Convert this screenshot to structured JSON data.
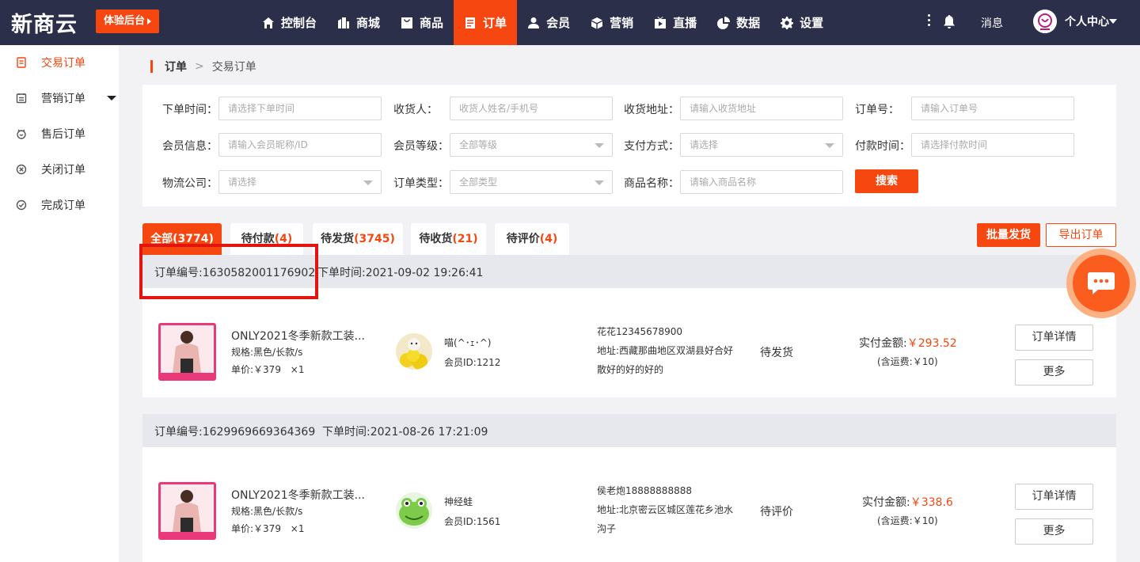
{
  "brand": {
    "logo": "新商云",
    "trial_button": "体验后台"
  },
  "nav": [
    {
      "label": "控制台",
      "icon": "home-icon"
    },
    {
      "label": "商城",
      "icon": "store-icon"
    },
    {
      "label": "商品",
      "icon": "goods-icon"
    },
    {
      "label": "订单",
      "icon": "order-icon",
      "active": true
    },
    {
      "label": "会员",
      "icon": "user-icon"
    },
    {
      "label": "营销",
      "icon": "cube-icon"
    },
    {
      "label": "直播",
      "icon": "live-icon"
    },
    {
      "label": "数据",
      "icon": "pie-chart-icon"
    },
    {
      "label": "设置",
      "icon": "gear-icon"
    }
  ],
  "header_right": {
    "messages": "消息",
    "user_center": "个人中心"
  },
  "sidebar": [
    {
      "label": "交易订单",
      "icon": "document-icon",
      "active": true
    },
    {
      "label": "营销订单",
      "icon": "list-icon"
    },
    {
      "label": "售后订单",
      "icon": "service-icon"
    },
    {
      "label": "关闭订单",
      "icon": "close-circle-icon"
    },
    {
      "label": "完成订单",
      "icon": "check-circle-icon"
    }
  ],
  "breadcrumb": {
    "parent": "订单",
    "separator": ">",
    "current": "交易订单"
  },
  "filters": {
    "order_time": {
      "label": "下单时间：",
      "placeholder": "请选择下单时间"
    },
    "receiver": {
      "label": "收货人：",
      "placeholder": "收货人姓名/手机号"
    },
    "address": {
      "label": "收货地址：",
      "placeholder": "请输入收货地址"
    },
    "order_no": {
      "label": "订单号：",
      "placeholder": "请输入订单号"
    },
    "member_info": {
      "label": "会员信息：",
      "placeholder": "请输入会员昵称/ID"
    },
    "member_level": {
      "label": "会员等级：",
      "value": "全部等级"
    },
    "pay_method": {
      "label": "支付方式：",
      "value": "请选择"
    },
    "pay_time": {
      "label": "付款时间：",
      "placeholder": "请选择付款时间"
    },
    "logistics": {
      "label": "物流公司：",
      "value": "请选择"
    },
    "order_type": {
      "label": "订单类型：",
      "value": "全部类型"
    },
    "product_name": {
      "label": "商品名称：",
      "placeholder": "请输入商品名称"
    },
    "search_button": "搜索"
  },
  "tabs": [
    {
      "label": "全部",
      "count": "(3774)",
      "active": true
    },
    {
      "label": "待付款",
      "count": "(4)"
    },
    {
      "label": "待发货",
      "count": "(3745)"
    },
    {
      "label": "待收货",
      "count": "(21)"
    },
    {
      "label": "待评价",
      "count": "(4)"
    }
  ],
  "actions": {
    "batch_ship": "批量发货",
    "export": "导出订单"
  },
  "orders": [
    {
      "order_no": "订单编号:1630582001176902",
      "order_time": "下单时间:2021-09-02 19:26:41",
      "product_title": "ONLY2021冬季新款工装...",
      "spec": "规格:黑色/长款/s",
      "unit_price": "单价:￥379",
      "qty": "×1",
      "member_name": "喵(^･ｪ･^)",
      "member_id": "会员ID:1212",
      "receiver": "花花12345678900",
      "address_line1": "地址:西藏那曲地区双湖县好合好",
      "address_line2": "散好的好的好的",
      "status": "待发货",
      "paid_label": "实付金额:",
      "paid_amount": "￥293.52",
      "shipping": "(含运费:￥10)",
      "detail_button": "订单详情",
      "more_button": "更多"
    },
    {
      "order_no": "订单编号:1629969669364369",
      "order_time": "下单时间:2021-08-26 17:21:09",
      "product_title": "ONLY2021冬季新款工装...",
      "spec": "规格:黑色/长款/s",
      "unit_price": "单价:￥379",
      "qty": "×1",
      "member_name": "神经蛙",
      "member_id": "会员ID:1561",
      "receiver": "侯老炮18888888888",
      "address_line1": "地址:北京密云区城区莲花乡池水",
      "address_line2": "沟子",
      "status": "待评价",
      "paid_label": "实付金额:",
      "paid_amount": "￥338.6",
      "shipping": "(含运费:￥10)",
      "detail_button": "订单详情",
      "more_button": "更多"
    }
  ],
  "colors": {
    "accent": "#f5470f",
    "topbar": "#2b2f4a",
    "highlight": "#e3140e"
  }
}
